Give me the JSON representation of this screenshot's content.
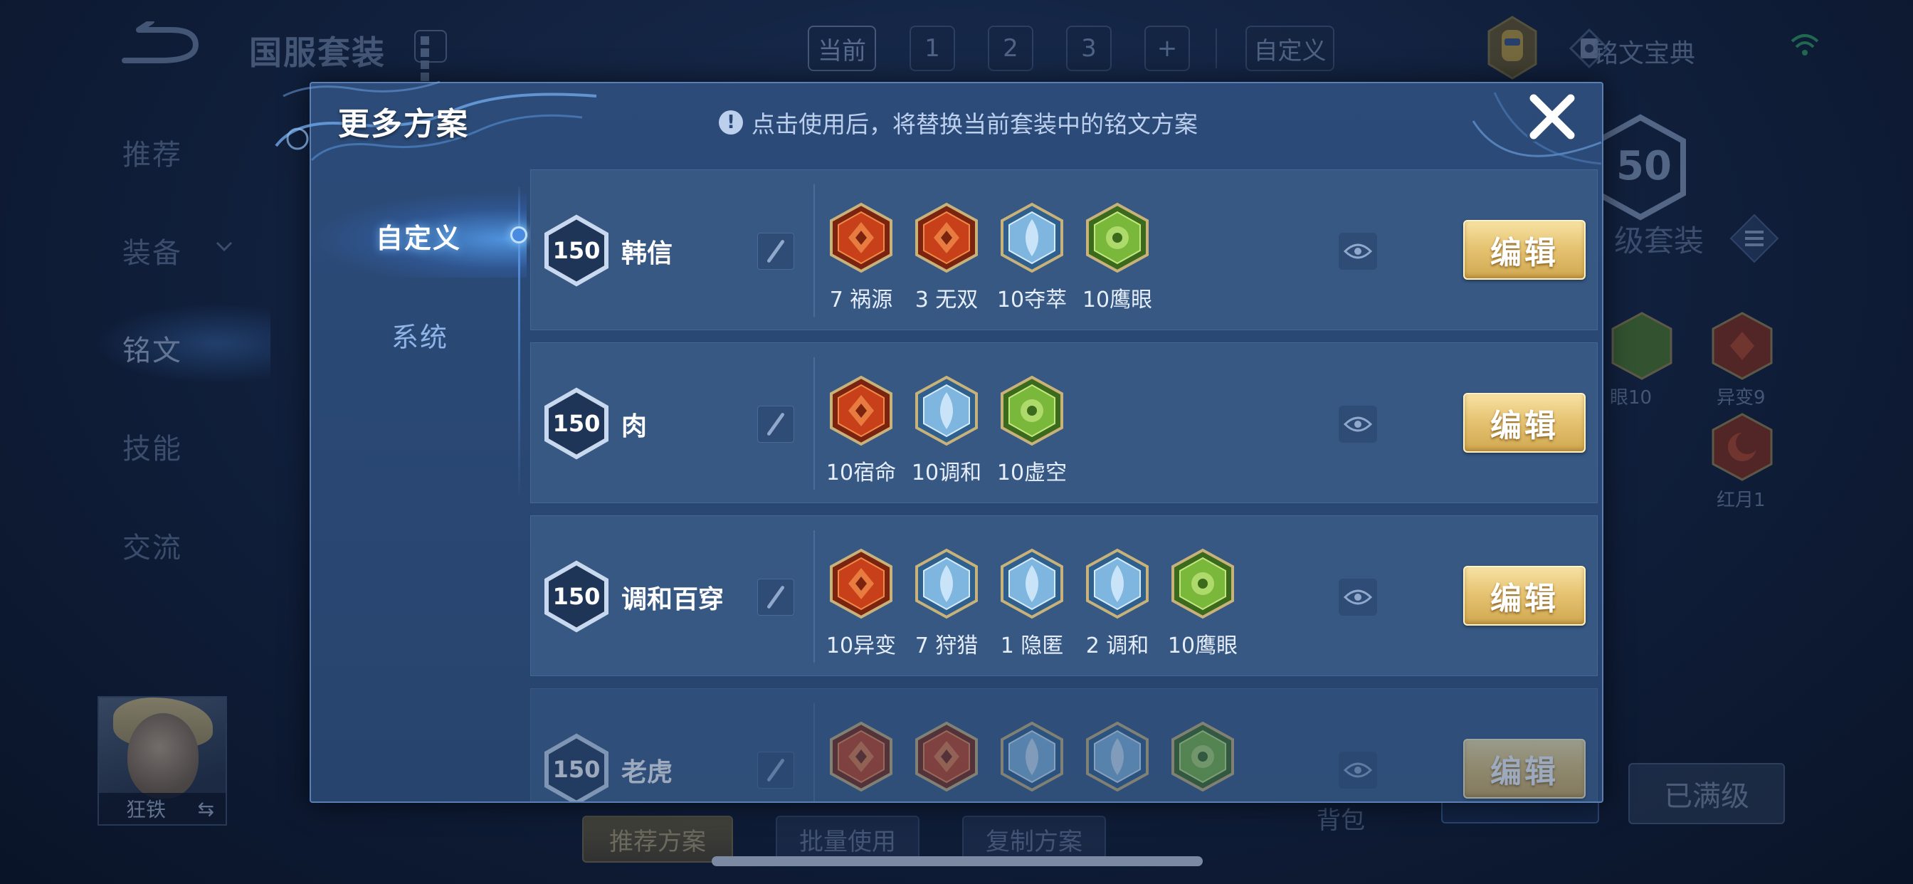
{
  "background_page": {
    "title": "国服套装",
    "set_tabs": [
      "当前",
      "1",
      "2",
      "3",
      "+"
    ],
    "custom_tab": "自定义",
    "codex_label": "铭文宝典",
    "side_nav": [
      {
        "label": "推荐",
        "active": false
      },
      {
        "label": "装备",
        "active": false
      },
      {
        "label": "铭文",
        "active": true
      },
      {
        "label": "技能",
        "active": false
      },
      {
        "label": "交流",
        "active": false
      }
    ],
    "right_panel": {
      "badge_fragment": "50",
      "set_label_fragment": "级套装",
      "runes": [
        {
          "label": "眼10",
          "icon": "rune-green-icon"
        },
        {
          "label": "异变9",
          "icon": "rune-red-icon"
        },
        {
          "label": "红月1",
          "icon": "rune-red-moon-icon"
        }
      ]
    },
    "hero": {
      "name": "狂铁",
      "swap_symbol": "⇆"
    },
    "bottom_buttons": [
      "推荐方案",
      "批量使用",
      "复制方案"
    ],
    "bag_label": "背包",
    "max_level_label": "已满级"
  },
  "modal": {
    "title": "更多方案",
    "notice": "点击使用后，将替换当前套装中的铭文方案",
    "notice_icon": "!",
    "close_icon": "close-icon",
    "tabs": [
      {
        "label": "自定义",
        "active": true
      },
      {
        "label": "系统",
        "active": false
      }
    ],
    "edit_label": "编辑",
    "plans": [
      {
        "level": "150",
        "name": "韩信",
        "runes": [
          {
            "label": "7 祸源",
            "color": "#d9541f",
            "style": "red"
          },
          {
            "label": "3 无双",
            "color": "#d9541f",
            "style": "red"
          },
          {
            "label": "10夺萃",
            "color": "#6fa8d8",
            "style": "blue"
          },
          {
            "label": "10鹰眼",
            "color": "#7ab83c",
            "style": "green"
          }
        ]
      },
      {
        "level": "150",
        "name": "肉",
        "runes": [
          {
            "label": "10宿命",
            "color": "#d9541f",
            "style": "red"
          },
          {
            "label": "10调和",
            "color": "#6fa8d8",
            "style": "blue"
          },
          {
            "label": "10虚空",
            "color": "#7ab83c",
            "style": "green"
          }
        ]
      },
      {
        "level": "150",
        "name": "调和百穿",
        "runes": [
          {
            "label": "10异变",
            "color": "#d9541f",
            "style": "red"
          },
          {
            "label": "7 狩猎",
            "color": "#6fa8d8",
            "style": "blue"
          },
          {
            "label": "1 隐匿",
            "color": "#6fa8d8",
            "style": "blue"
          },
          {
            "label": "2 调和",
            "color": "#6fa8d8",
            "style": "blue"
          },
          {
            "label": "10鹰眼",
            "color": "#7ab83c",
            "style": "green"
          }
        ]
      },
      {
        "level": "150",
        "name": "老虎",
        "runes": [
          {
            "label": "",
            "color": "#d9541f",
            "style": "red"
          },
          {
            "label": "",
            "color": "#d9541f",
            "style": "red"
          },
          {
            "label": "",
            "color": "#6fa8d8",
            "style": "blue"
          },
          {
            "label": "",
            "color": "#6fa8d8",
            "style": "blue"
          },
          {
            "label": "",
            "color": "#7ab83c",
            "style": "green"
          }
        ]
      }
    ]
  },
  "colors": {
    "gold_button": "#e6c473",
    "modal_bg": "#2c4b78",
    "row_bg": "#365883"
  }
}
